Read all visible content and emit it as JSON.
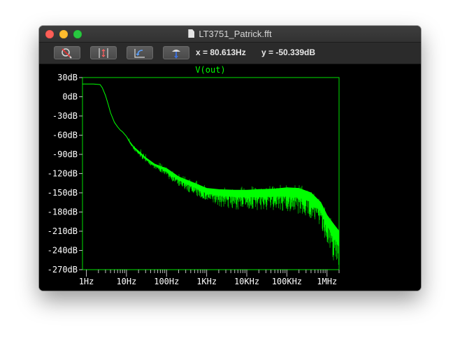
{
  "window": {
    "title": "LT3751_Patrick.fft"
  },
  "toolbar": {
    "buttons": [
      {
        "name": "zoom-out-button",
        "icon": "zoom-cancel-icon"
      },
      {
        "name": "autoscale-y-button",
        "icon": "vertical-range-icon"
      },
      {
        "name": "zoom-back-button",
        "icon": "zoom-back-icon"
      },
      {
        "name": "probe-button",
        "icon": "probe-icon"
      }
    ],
    "cursor_x": "x = 80.613Hz",
    "cursor_y": "y = -50.339dB"
  },
  "colors": {
    "trace": "#00ff00",
    "axis": "#c0c0c0",
    "grid_frame": "#00e000",
    "label": "#ffffff"
  },
  "chart_data": {
    "type": "line",
    "title": "V(out)",
    "xscale": "log",
    "xlim": [
      0.8,
      2000000
    ],
    "ylim": [
      -270,
      30
    ],
    "yticks": [
      30,
      0,
      -30,
      -60,
      -90,
      -120,
      -150,
      -180,
      -210,
      -240,
      -270
    ],
    "ytick_labels": [
      "30dB",
      "0dB",
      "-30dB",
      "-60dB",
      "-90dB",
      "-120dB",
      "-150dB",
      "-180dB",
      "-210dB",
      "-240dB",
      "-270dB"
    ],
    "xticks": [
      1,
      10,
      100,
      1000,
      10000,
      100000,
      1000000
    ],
    "xtick_labels": [
      "1Hz",
      "10Hz",
      "100Hz",
      "1KHz",
      "10KHz",
      "100KHz",
      "1MHz"
    ],
    "series": [
      {
        "name": "V(out)",
        "x": [
          0.8,
          1,
          1.5,
          2.2,
          2.5,
          3,
          3.5,
          4,
          5,
          6,
          7,
          8,
          10,
          12,
          15,
          20,
          30,
          50,
          80,
          100,
          200,
          500,
          1000,
          2000,
          5000,
          10000,
          20000,
          50000,
          100000,
          200000,
          400000,
          700000,
          1000000,
          1500000,
          2000000
        ],
        "y": [
          20,
          20,
          20,
          19,
          14,
          2,
          -12,
          -25,
          -40,
          -47,
          -52,
          -55,
          -62,
          -70,
          -78,
          -85,
          -95,
          -105,
          -110,
          -112,
          -125,
          -135,
          -143,
          -145,
          -146,
          -146,
          -145,
          -144,
          -142,
          -143,
          -150,
          -165,
          -185,
          -200,
          -210
        ],
        "noise_floor_y": [
          20,
          20,
          20,
          19,
          14,
          2,
          -12,
          -25,
          -40,
          -47,
          -52,
          -55,
          -63,
          -73,
          -83,
          -92,
          -102,
          -112,
          -120,
          -126,
          -140,
          -155,
          -165,
          -172,
          -176,
          -177,
          -178,
          -178,
          -180,
          -185,
          -190,
          -205,
          -230,
          -260,
          -265
        ]
      }
    ]
  }
}
